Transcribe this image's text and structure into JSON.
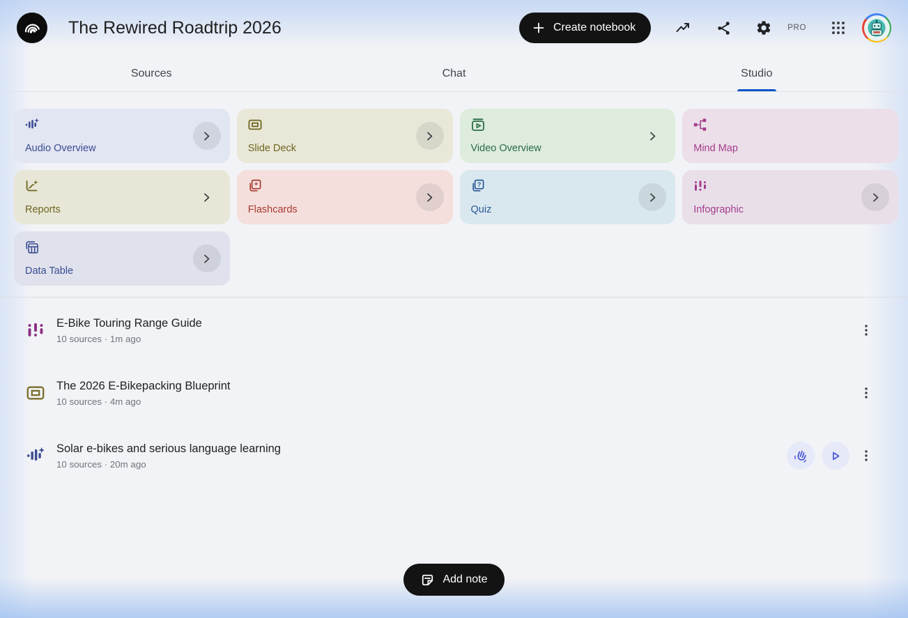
{
  "header": {
    "title": "The Rewired Roadtrip 2026",
    "create_button_label": "Create notebook",
    "pro_label": "PRO",
    "icons": [
      "notebooklm-logo",
      "plus-icon",
      "trending-up-icon",
      "share-icon",
      "settings-gear-icon",
      "apps-grid-icon",
      "avatar"
    ]
  },
  "tabs": [
    {
      "label": "Sources",
      "active": false
    },
    {
      "label": "Chat",
      "active": false
    },
    {
      "label": "Studio",
      "active": true
    }
  ],
  "studio_cards": [
    {
      "id": "audio-overview",
      "label": "Audio Overview",
      "icon": "audio-overview-icon",
      "bg": "#e2e5f2",
      "fg": "#3a4c92",
      "chevron": "circle"
    },
    {
      "id": "slide-deck",
      "label": "Slide Deck",
      "icon": "slide-deck-icon",
      "bg": "#e9e8d8",
      "fg": "#6d6520",
      "chevron": "circle"
    },
    {
      "id": "video-overview",
      "label": "Video Overview",
      "icon": "video-overview-icon",
      "bg": "#ddecdd",
      "fg": "#2c6b46",
      "chevron": "plain"
    },
    {
      "id": "mind-map",
      "label": "Mind Map",
      "icon": "mind-map-icon",
      "bg": "#ecdfe9",
      "fg": "#a33c8c",
      "chevron": "none"
    },
    {
      "id": "reports",
      "label": "Reports",
      "icon": "reports-icon",
      "bg": "#e8e7d7",
      "fg": "#6d6520",
      "chevron": "plain"
    },
    {
      "id": "flashcards",
      "label": "Flashcards",
      "icon": "flashcards-icon",
      "bg": "#f4dfdc",
      "fg": "#a83a31",
      "chevron": "circle"
    },
    {
      "id": "quiz",
      "label": "Quiz",
      "icon": "quiz-icon",
      "bg": "#d9e8ee",
      "fg": "#2b5797",
      "chevron": "circle"
    },
    {
      "id": "infographic",
      "label": "Infographic",
      "icon": "infographic-icon",
      "bg": "#e9dfe9",
      "fg": "#a33c8c",
      "chevron": "circle"
    },
    {
      "id": "data-table",
      "label": "Data Table",
      "icon": "data-table-icon",
      "bg": "#dfe2ec",
      "fg": "#3a4c92",
      "chevron": "circle"
    }
  ],
  "artifacts": [
    {
      "title": "E-Bike Touring Range Guide",
      "meta": "10 sources · 1m ago",
      "icon": "infographic-icon",
      "icon_color": "#8c2f84",
      "audio_controls": false
    },
    {
      "title": "The 2026 E-Bikepacking Blueprint",
      "meta": "10 sources · 4m ago",
      "icon": "slide-deck-icon",
      "icon_color": "#7a6e2d",
      "audio_controls": false
    },
    {
      "title": "Solar e-bikes and serious language learning",
      "meta": "10 sources · 20m ago",
      "icon": "audio-overview-icon",
      "icon_color": "#3a4c92",
      "audio_controls": true,
      "control_icons": [
        "interactive-hand-icon",
        "play-icon"
      ]
    }
  ],
  "footer": {
    "add_note_label": "Add note",
    "icons": [
      "note-icon"
    ]
  },
  "colors": {
    "tab_underline": "#0f56c9",
    "pill_button_bg": "#131314",
    "round_action_bg": "#e6e9f8",
    "round_action_fg": "#4b58d8",
    "meta_text": "#6f7378",
    "avatar_ring": [
      "#4285f4",
      "#34a853",
      "#fbbc05",
      "#ea4335"
    ]
  }
}
